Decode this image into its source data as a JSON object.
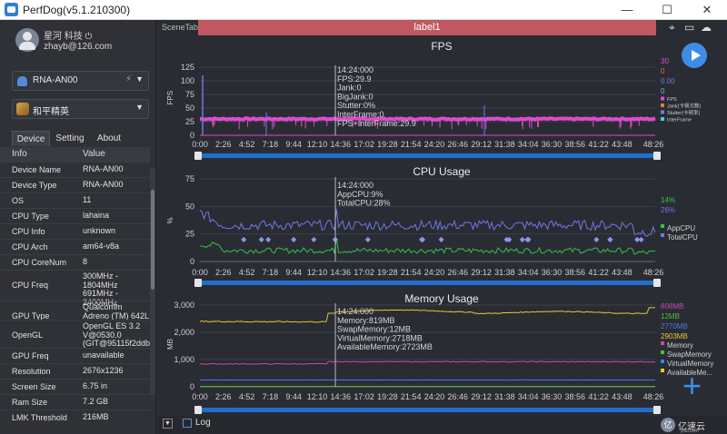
{
  "window": {
    "title": "PerfDog(v5.1.210300)",
    "min": "—",
    "max": "☐",
    "close": "✕"
  },
  "user": {
    "name": "星河 科技 ⏻",
    "email": "zhayb@126.com"
  },
  "device_selector": {
    "value": "RNA-AN00"
  },
  "app_selector": {
    "value": "和平精英"
  },
  "tabs": [
    "Device",
    "Setting",
    "About"
  ],
  "info_table": {
    "headers": [
      "Info",
      "Value"
    ],
    "rows": [
      {
        "key": "Device Name",
        "value": "RNA-AN00"
      },
      {
        "key": "Device Type",
        "value": "RNA-AN00"
      },
      {
        "key": "OS",
        "value": "11"
      },
      {
        "key": "CPU Type",
        "value": "lahaina"
      },
      {
        "key": "CPU Info",
        "value": "unknown"
      },
      {
        "key": "CPU Arch",
        "value": "am64-v8a"
      },
      {
        "key": "CPU CoreNum",
        "value": "8"
      },
      {
        "key": "CPU Freq",
        "value": "300MHz -\n1804MHz\n691MHz -\n2400MHz"
      },
      {
        "key": "GPU Type",
        "value": "Qualcomm\nAdreno (TM) 642L"
      },
      {
        "key": "OpenGL",
        "value": "OpenGL ES 3.2\nV@0530.0\n(GIT@95115f2ddb"
      },
      {
        "key": "GPU Freq",
        "value": "unavailable"
      },
      {
        "key": "Resolution",
        "value": "2676x1236"
      },
      {
        "key": "Screen Size",
        "value": "6.75 in"
      },
      {
        "key": "Ram Size",
        "value": "7.2 GB"
      },
      {
        "key": "LMK Threshold",
        "value": "216MB"
      }
    ]
  },
  "scene": {
    "tab_label": "SceneTab",
    "label": "label1"
  },
  "toolbar_icons": [
    "location-icon",
    "folder-icon",
    "cloud-icon"
  ],
  "time_axis": [
    "0:00",
    "2:26",
    "4:52",
    "7:18",
    "9:44",
    "12:10",
    "14:36",
    "17:02",
    "19:28",
    "21:54",
    "24:20",
    "26:46",
    "29:12",
    "31:38",
    "34:04",
    "36:30",
    "38:56",
    "41:22",
    "43:48",
    "48:26"
  ],
  "cursor": {
    "time": "14:24:000"
  },
  "colors": {
    "fps": "#e04ad1",
    "cpu_app": "#33c24a",
    "cpu_total": "#6e79e4",
    "mem": "#e6c82e",
    "swap": "#4fbf3d",
    "virtual": "#3f7de8",
    "available": "#e6c82e",
    "mem_purple": "#c24ab8",
    "accent": "#3b8de7"
  },
  "chart_data": [
    {
      "type": "line",
      "title": "FPS",
      "ylabel": "FPS",
      "ylim": [
        0,
        125
      ],
      "yticks": [
        0,
        25,
        50,
        75,
        100,
        125
      ],
      "tooltip": [
        "14:24:000",
        "FPS:29.9",
        "Jank:0",
        "BigJank:0",
        "Stutter:0%",
        "InterFrame:0",
        "FPS+InterFrame:29.9"
      ],
      "legend_values": [
        "30",
        "0",
        "0.00",
        "0"
      ],
      "legend_value_colors": [
        "#e04ad1",
        "#e07a3a",
        "#6e79e4",
        "#48c8e0"
      ],
      "legend": [
        {
          "name": "FPS",
          "color": "#e04ad1"
        },
        {
          "name": "Jank(卡顿次数)",
          "color": "#e07a3a"
        },
        {
          "name": "Stutter(卡顿率)",
          "color": "#6e79e4"
        },
        {
          "name": "InterFrame",
          "color": "#48c8e0"
        }
      ],
      "series": [
        {
          "name": "FPS",
          "approx_value": 30
        },
        {
          "name": "InterFrame",
          "approx_value": 0
        }
      ]
    },
    {
      "type": "line",
      "title": "CPU Usage",
      "ylabel": "%",
      "ylim": [
        0,
        75
      ],
      "yticks": [
        0,
        25,
        50,
        75
      ],
      "tooltip": [
        "14:24:000",
        "AppCPU:9%",
        "TotalCPU:28%"
      ],
      "legend_values": [
        "14%",
        "26%"
      ],
      "legend_value_colors": [
        "#33c24a",
        "#6e79e4"
      ],
      "legend": [
        {
          "name": "AppCPU",
          "color": "#33c24a"
        },
        {
          "name": "TotalCPU",
          "color": "#6e79e4"
        }
      ],
      "series": [
        {
          "name": "AppCPU",
          "approx_value": 10
        },
        {
          "name": "TotalCPU",
          "approx_value": 33
        }
      ]
    },
    {
      "type": "line",
      "title": "Memory Usage",
      "ylabel": "MB",
      "ylim": [
        0,
        3000
      ],
      "yticks": [
        "0",
        "1,000",
        "2,000",
        "3,000"
      ],
      "tooltip": [
        "14:24:000",
        "Memory:819MB",
        "SwapMemory:12MB",
        "VirtualMemory:2718MB",
        "AvailableMemory:2723MB"
      ],
      "legend_values": [
        "808MB",
        "12MB",
        "2770MB",
        "2903MB"
      ],
      "legend_value_colors": [
        "#c24ab8",
        "#4fbf3d",
        "#3f7de8",
        "#e6c82e"
      ],
      "legend": [
        {
          "name": "Memory",
          "color": "#c24ab8"
        },
        {
          "name": "SwapMemory",
          "color": "#4fbf3d"
        },
        {
          "name": "VirtualMemory",
          "color": "#3f7de8"
        },
        {
          "name": "AvailableMe...",
          "color": "#e6c82e"
        }
      ],
      "series": [
        {
          "name": "Memory",
          "approx_value": 900
        },
        {
          "name": "SwapMemory",
          "approx_value": 12
        },
        {
          "name": "VirtualMemory",
          "approx_value": 250
        },
        {
          "name": "AvailableMemory",
          "approx_value": 2700
        }
      ]
    }
  ],
  "bottom": {
    "collapse": "▼",
    "log_label": "Log",
    "watermark_icon": "亿",
    "watermark": "亿速云",
    "watermark_sub": "yisu.com"
  }
}
